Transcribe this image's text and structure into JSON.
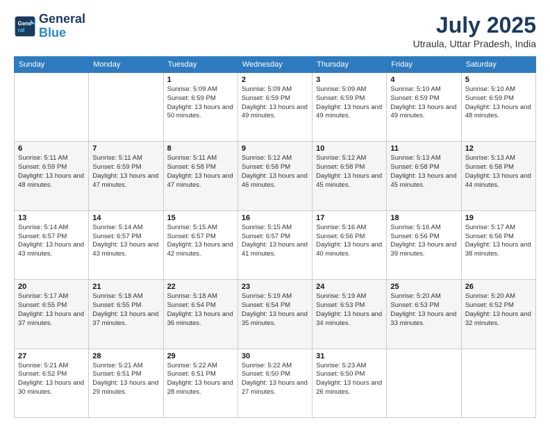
{
  "header": {
    "logo_line1": "General",
    "logo_line2": "Blue",
    "month_year": "July 2025",
    "location": "Utraula, Uttar Pradesh, India"
  },
  "weekdays": [
    "Sunday",
    "Monday",
    "Tuesday",
    "Wednesday",
    "Thursday",
    "Friday",
    "Saturday"
  ],
  "weeks": [
    [
      {
        "day": "",
        "info": ""
      },
      {
        "day": "",
        "info": ""
      },
      {
        "day": "1",
        "info": "Sunrise: 5:09 AM\nSunset: 6:59 PM\nDaylight: 13 hours and 50 minutes."
      },
      {
        "day": "2",
        "info": "Sunrise: 5:09 AM\nSunset: 6:59 PM\nDaylight: 13 hours and 49 minutes."
      },
      {
        "day": "3",
        "info": "Sunrise: 5:09 AM\nSunset: 6:59 PM\nDaylight: 13 hours and 49 minutes."
      },
      {
        "day": "4",
        "info": "Sunrise: 5:10 AM\nSunset: 6:59 PM\nDaylight: 13 hours and 49 minutes."
      },
      {
        "day": "5",
        "info": "Sunrise: 5:10 AM\nSunset: 6:59 PM\nDaylight: 13 hours and 48 minutes."
      }
    ],
    [
      {
        "day": "6",
        "info": "Sunrise: 5:11 AM\nSunset: 6:59 PM\nDaylight: 13 hours and 48 minutes."
      },
      {
        "day": "7",
        "info": "Sunrise: 5:11 AM\nSunset: 6:59 PM\nDaylight: 13 hours and 47 minutes."
      },
      {
        "day": "8",
        "info": "Sunrise: 5:11 AM\nSunset: 6:58 PM\nDaylight: 13 hours and 47 minutes."
      },
      {
        "day": "9",
        "info": "Sunrise: 5:12 AM\nSunset: 6:58 PM\nDaylight: 13 hours and 46 minutes."
      },
      {
        "day": "10",
        "info": "Sunrise: 5:12 AM\nSunset: 6:58 PM\nDaylight: 13 hours and 45 minutes."
      },
      {
        "day": "11",
        "info": "Sunrise: 5:13 AM\nSunset: 6:58 PM\nDaylight: 13 hours and 45 minutes."
      },
      {
        "day": "12",
        "info": "Sunrise: 5:13 AM\nSunset: 6:58 PM\nDaylight: 13 hours and 44 minutes."
      }
    ],
    [
      {
        "day": "13",
        "info": "Sunrise: 5:14 AM\nSunset: 6:57 PM\nDaylight: 13 hours and 43 minutes."
      },
      {
        "day": "14",
        "info": "Sunrise: 5:14 AM\nSunset: 6:57 PM\nDaylight: 13 hours and 43 minutes."
      },
      {
        "day": "15",
        "info": "Sunrise: 5:15 AM\nSunset: 6:57 PM\nDaylight: 13 hours and 42 minutes."
      },
      {
        "day": "16",
        "info": "Sunrise: 5:15 AM\nSunset: 6:57 PM\nDaylight: 13 hours and 41 minutes."
      },
      {
        "day": "17",
        "info": "Sunrise: 5:16 AM\nSunset: 6:56 PM\nDaylight: 13 hours and 40 minutes."
      },
      {
        "day": "18",
        "info": "Sunrise: 5:16 AM\nSunset: 6:56 PM\nDaylight: 13 hours and 39 minutes."
      },
      {
        "day": "19",
        "info": "Sunrise: 5:17 AM\nSunset: 6:56 PM\nDaylight: 13 hours and 38 minutes."
      }
    ],
    [
      {
        "day": "20",
        "info": "Sunrise: 5:17 AM\nSunset: 6:55 PM\nDaylight: 13 hours and 37 minutes."
      },
      {
        "day": "21",
        "info": "Sunrise: 5:18 AM\nSunset: 6:55 PM\nDaylight: 13 hours and 37 minutes."
      },
      {
        "day": "22",
        "info": "Sunrise: 5:18 AM\nSunset: 6:54 PM\nDaylight: 13 hours and 36 minutes."
      },
      {
        "day": "23",
        "info": "Sunrise: 5:19 AM\nSunset: 6:54 PM\nDaylight: 13 hours and 35 minutes."
      },
      {
        "day": "24",
        "info": "Sunrise: 5:19 AM\nSunset: 6:53 PM\nDaylight: 13 hours and 34 minutes."
      },
      {
        "day": "25",
        "info": "Sunrise: 5:20 AM\nSunset: 6:53 PM\nDaylight: 13 hours and 33 minutes."
      },
      {
        "day": "26",
        "info": "Sunrise: 5:20 AM\nSunset: 6:52 PM\nDaylight: 13 hours and 32 minutes."
      }
    ],
    [
      {
        "day": "27",
        "info": "Sunrise: 5:21 AM\nSunset: 6:52 PM\nDaylight: 13 hours and 30 minutes."
      },
      {
        "day": "28",
        "info": "Sunrise: 5:21 AM\nSunset: 6:51 PM\nDaylight: 13 hours and 29 minutes."
      },
      {
        "day": "29",
        "info": "Sunrise: 5:22 AM\nSunset: 6:51 PM\nDaylight: 13 hours and 28 minutes."
      },
      {
        "day": "30",
        "info": "Sunrise: 5:22 AM\nSunset: 6:50 PM\nDaylight: 13 hours and 27 minutes."
      },
      {
        "day": "31",
        "info": "Sunrise: 5:23 AM\nSunset: 6:50 PM\nDaylight: 13 hours and 26 minutes."
      },
      {
        "day": "",
        "info": ""
      },
      {
        "day": "",
        "info": ""
      }
    ]
  ]
}
